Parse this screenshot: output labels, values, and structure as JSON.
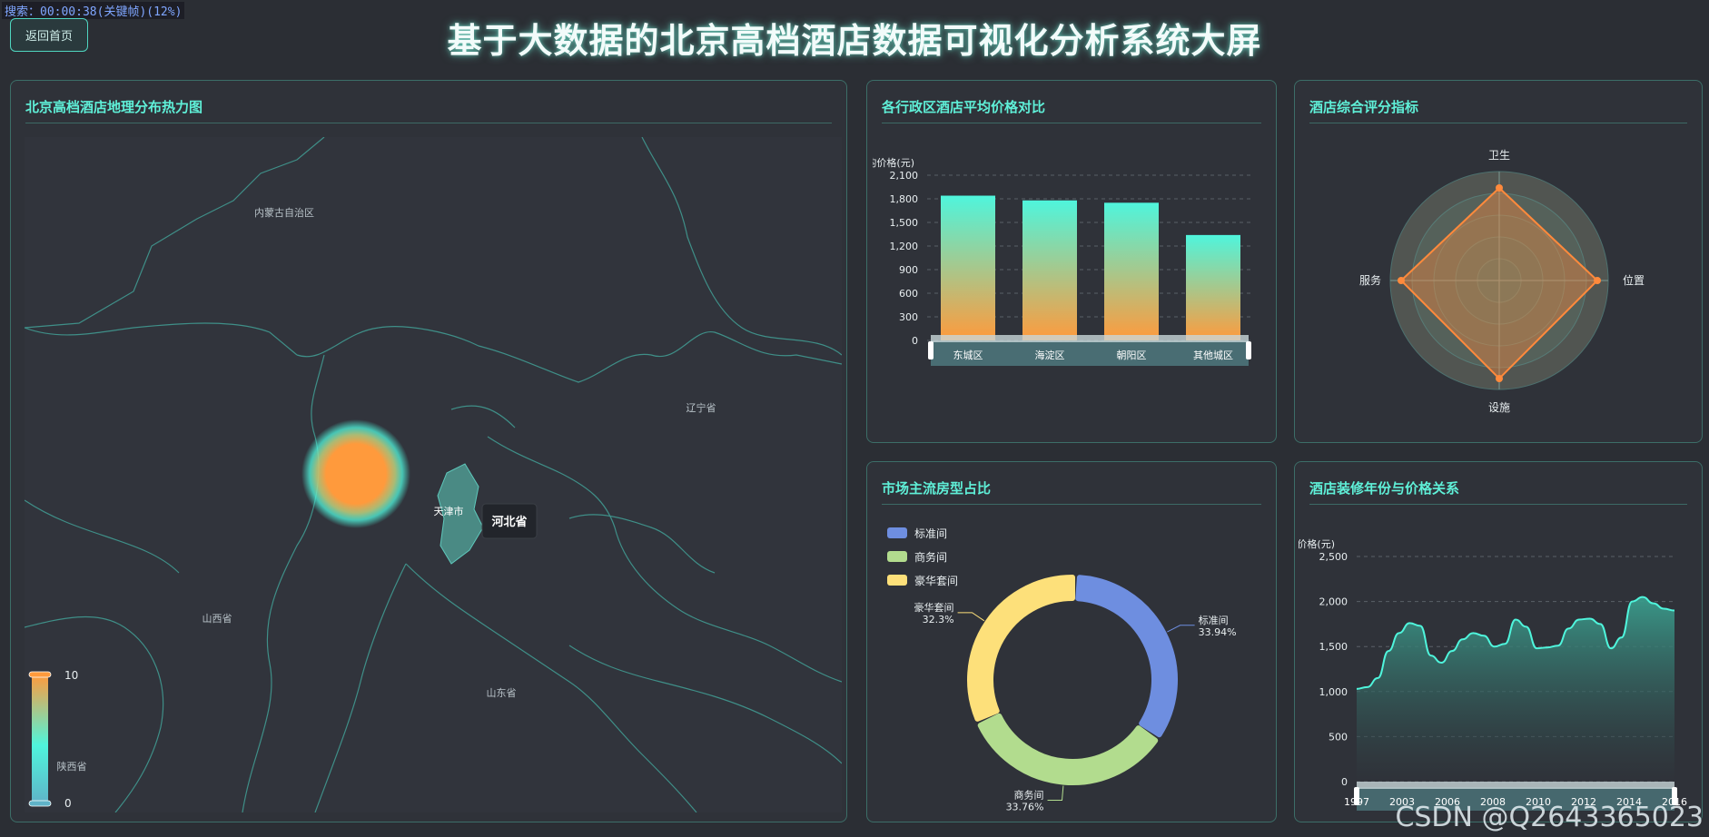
{
  "search_tag": "搜索：00:00:38(关键帧)(12%)",
  "back_button": "返回首页",
  "title": "基于大数据的北京高档酒店数据可视化分析系统大屏",
  "watermark": "CSDN @Q2643365023",
  "map_panel": {
    "title": "北京高档酒店地理分布热力图",
    "labels": {
      "neimenggu": "内蒙古自治区",
      "liaoning": "辽宁省",
      "tianjin": "天津市",
      "shanxi": "山西省",
      "shandong": "山东省",
      "shaanxi": "陕西省"
    },
    "tooltip": "河北省",
    "legend_max": "10",
    "legend_min": "0",
    "colors": {
      "hot": "#ff9a3c",
      "mid": "#4ff5dc",
      "low": "#5fb3c8"
    }
  },
  "bar_panel": {
    "title": "各行政区酒店平均价格对比",
    "chart_data": {
      "type": "bar",
      "title": "各行政区酒店平均价格对比",
      "ylabel": "均价格(元)",
      "categories": [
        "东城区",
        "海淀区",
        "朝阳区",
        "其他城区"
      ],
      "values": [
        1840,
        1780,
        1750,
        1340
      ],
      "ylim": [
        0,
        2100
      ],
      "yticks": [
        "0",
        "300",
        "600",
        "900",
        "1,200",
        "1,500",
        "1,800",
        "2,100"
      ]
    }
  },
  "radar_panel": {
    "title": "酒店综合评分指标",
    "chart_data": {
      "type": "radar",
      "indicators": [
        "卫生",
        "位置",
        "设施",
        "服务"
      ],
      "values": [
        0.85,
        0.9,
        0.9,
        0.9
      ]
    }
  },
  "pie_panel": {
    "title": "市场主流房型占比",
    "chart_data": {
      "type": "pie",
      "slices": [
        {
          "name": "标准间",
          "value": 33.94,
          "label": "33.94%",
          "color": "#6e8ee0"
        },
        {
          "name": "商务间",
          "value": 33.76,
          "label": "33.76%",
          "color": "#b2dc8e"
        },
        {
          "name": "豪华套间",
          "value": 32.3,
          "label": "32.3%",
          "color": "#fde07a"
        }
      ]
    }
  },
  "area_panel": {
    "title": "酒店装修年份与价格关系",
    "chart_data": {
      "type": "area",
      "ylabel": "均价格(元)",
      "ylim": [
        0,
        2500
      ],
      "yticks": [
        "0",
        "500",
        "1,000",
        "1,500",
        "2,000",
        "2,500"
      ],
      "xticks": [
        "1997",
        "2003",
        "2006",
        "2008",
        "2010",
        "2012",
        "2014",
        "2016"
      ],
      "x": [
        0,
        1,
        2,
        3,
        4,
        5,
        6,
        7,
        8,
        9,
        10,
        11,
        12,
        13,
        14,
        15,
        16,
        17,
        18,
        19,
        20,
        21,
        22,
        23,
        24,
        25,
        26,
        27,
        28,
        29,
        30
      ],
      "values": [
        1030,
        1050,
        1150,
        1450,
        1650,
        1760,
        1730,
        1400,
        1320,
        1450,
        1580,
        1650,
        1620,
        1500,
        1530,
        1800,
        1720,
        1480,
        1490,
        1510,
        1700,
        1800,
        1810,
        1750,
        1480,
        1600,
        2000,
        2050,
        1980,
        1920,
        1900
      ]
    }
  }
}
